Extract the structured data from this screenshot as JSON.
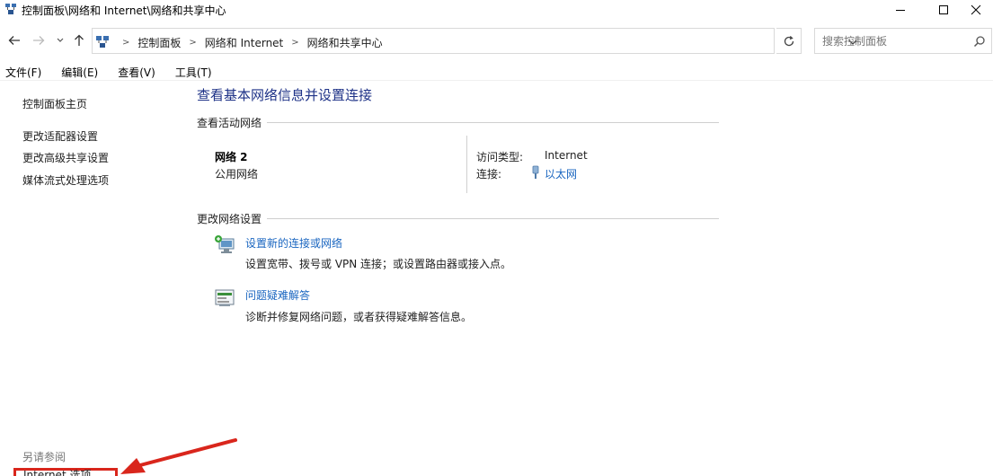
{
  "window": {
    "title": "控制面板\\网络和 Internet\\网络和共享中心"
  },
  "address": {
    "crumbs": [
      "控制面板",
      "网络和 Internet",
      "网络和共享中心"
    ],
    "search_placeholder": "搜索控制面板"
  },
  "menu": [
    "文件(F)",
    "编辑(E)",
    "查看(V)",
    "工具(T)"
  ],
  "sidebar": {
    "home": "控制面板主页",
    "links": [
      "更改适配器设置",
      "更改高级共享设置",
      "媒体流式处理选项"
    ],
    "see_also": "另请参阅",
    "internet_options": "Internet 选项"
  },
  "main": {
    "title": "查看基本网络信息并设置连接",
    "active_networks_heading": "查看活动网络",
    "network": {
      "name": "网络 2",
      "category": "公用网络",
      "access_type_label": "访问类型:",
      "access_type_value": "Internet",
      "connection_label": "连接:",
      "connection_value": "以太网"
    },
    "change_settings_heading": "更改网络设置",
    "tasks": [
      {
        "icon": "network-setup-icon",
        "link": "设置新的连接或网络",
        "desc": "设置宽带、拨号或 VPN 连接；或设置路由器或接入点。"
      },
      {
        "icon": "troubleshoot-icon",
        "link": "问题疑难解答",
        "desc": "诊断并修复网络问题，或者获得疑难解答信息。"
      }
    ]
  },
  "colors": {
    "title_blue": "#1e3287",
    "link_blue": "#1a66c0",
    "highlight_red": "#d9261c"
  }
}
